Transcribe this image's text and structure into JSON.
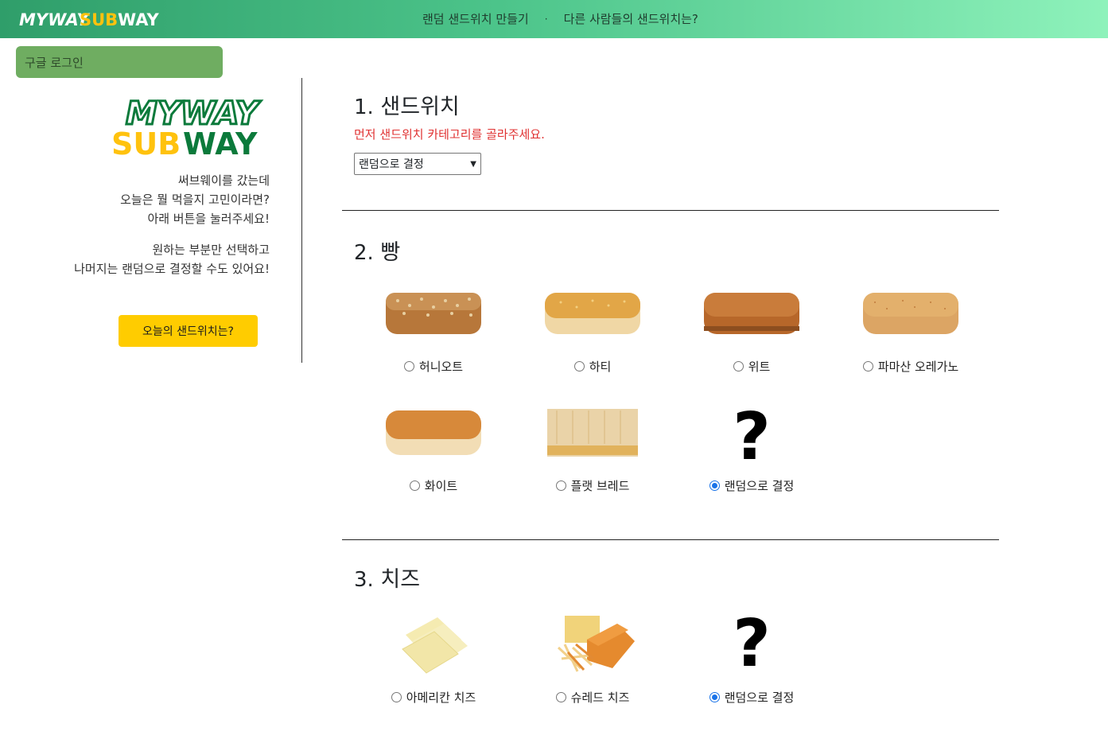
{
  "header": {
    "logo_left": "MYWAY",
    "logo_right": "SUBWAY",
    "nav": [
      "랜덤 샌드위치 만들기",
      "·",
      "다른 사람들의 샌드위치는?"
    ]
  },
  "login_label": "구글 로그인",
  "sidebar": {
    "logo_top": "MYWAY",
    "logo_bottom": "SUBWAY",
    "intro_lines": [
      "써브웨이를 갔는데",
      "오늘은 뭘 먹을지 고민이라면?",
      "아래 버튼을 눌러주세요!"
    ],
    "option_lines": [
      "원하는 부분만 선택하고",
      "나머지는 랜덤으로 결정할 수도 있어요!"
    ],
    "button_label": "오늘의 샌드위치는?"
  },
  "section1": {
    "num": "1.",
    "title": "샌드위치",
    "hint": "먼저 샌드위치 카테고리를 골라주세요.",
    "select_value": "랜덤으로 결정"
  },
  "section2": {
    "num": "2.",
    "title": "빵",
    "options": [
      {
        "label": "허니오트",
        "checked": false,
        "image": "honey-oat-bread"
      },
      {
        "label": "하티",
        "checked": false,
        "image": "hearty-bread"
      },
      {
        "label": "위트",
        "checked": false,
        "image": "wheat-bread"
      },
      {
        "label": "파마산 오레가노",
        "checked": false,
        "image": "parmesan-oregano-bread"
      },
      {
        "label": "화이트",
        "checked": false,
        "image": "white-bread"
      },
      {
        "label": "플랫 브레드",
        "checked": false,
        "image": "flat-bread"
      },
      {
        "label": "랜덤으로 결정",
        "checked": true,
        "image": "question-mark"
      }
    ]
  },
  "section3": {
    "num": "3.",
    "title": "치즈",
    "options": [
      {
        "label": "아메리칸 치즈",
        "checked": false,
        "image": "american-cheese"
      },
      {
        "label": "슈레드 치즈",
        "checked": false,
        "image": "shredded-cheese"
      },
      {
        "label": "랜덤으로 결정",
        "checked": true,
        "image": "question-mark"
      }
    ]
  },
  "question_mark": "?",
  "colors": {
    "header_start": "#2f9e6a",
    "header_end": "#8ef2bb",
    "login_bg": "#6fad61",
    "button_bg": "#ffcc00",
    "hint": "#e03131",
    "logo_green": "#0b7a3b",
    "logo_yellow": "#ffc20e"
  }
}
